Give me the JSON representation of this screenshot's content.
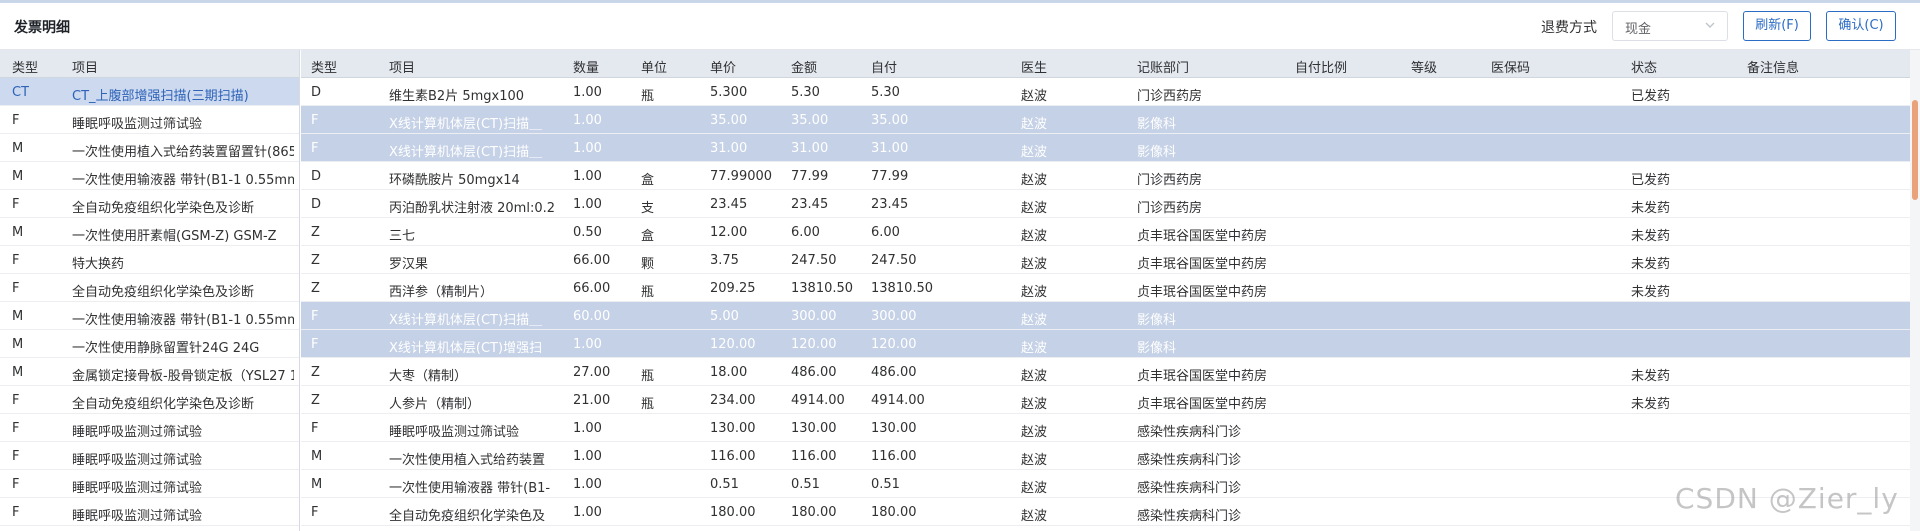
{
  "header": {
    "title": "发票明细",
    "refund_label": "退费方式",
    "refund_value": "现金",
    "refresh_label": "刷新(F)",
    "confirm_label": "确认(C)"
  },
  "left_table": {
    "columns": [
      "类型",
      "项目"
    ],
    "rows": [
      [
        "CT",
        "CT_上腹部增强扫描(三期扫描)"
      ],
      [
        "F",
        "睡眠呼吸监测过筛试验"
      ],
      [
        "M",
        "一次性使用植入式给药装置留置针(865"
      ],
      [
        "M",
        "一次性使用输液器 带针(B1-1 0.55mm"
      ],
      [
        "F",
        "全自动免疫组织化学染色及诊断"
      ],
      [
        "M",
        "一次性使用肝素帽(GSM-Z) GSM-Z"
      ],
      [
        "F",
        "特大换药"
      ],
      [
        "F",
        "全自动免疫组织化学染色及诊断"
      ],
      [
        "M",
        "一次性使用输液器 带针(B1-1 0.55mm"
      ],
      [
        "M",
        "一次性使用静脉留置针24G 24G"
      ],
      [
        "M",
        "金属锁定接骨板-股骨锁定板（YSL27 1"
      ],
      [
        "F",
        "全自动免疫组织化学染色及诊断"
      ],
      [
        "F",
        "睡眠呼吸监测过筛试验"
      ],
      [
        "F",
        "睡眠呼吸监测过筛试验"
      ],
      [
        "F",
        "睡眠呼吸监测过筛试验"
      ],
      [
        "F",
        "睡眠呼吸监测过筛试验"
      ]
    ]
  },
  "right_table": {
    "columns": [
      "类型",
      "项目",
      "数量",
      "单位",
      "单价",
      "金额",
      "自付",
      "医生",
      "记账部门",
      "自付比例",
      "等级",
      "医保码",
      "状态",
      "备注信息"
    ],
    "rows": [
      {
        "cells": [
          "D",
          "维生素B2片 5mgx100",
          "1.00",
          "瓶",
          "5.300",
          "5.30",
          "5.30",
          "赵波",
          "门诊西药房",
          "",
          "",
          "",
          "已发药",
          ""
        ],
        "style": ""
      },
      {
        "cells": [
          "F",
          "X线计算机体层(CT)扫描＿",
          "1.00",
          "",
          "35.00",
          "35.00",
          "35.00",
          "赵波",
          "影像科",
          "",
          "",
          "",
          "",
          ""
        ],
        "style": "blue"
      },
      {
        "cells": [
          "F",
          "X线计算机体层(CT)扫描＿",
          "1.00",
          "",
          "31.00",
          "31.00",
          "31.00",
          "赵波",
          "影像科",
          "",
          "",
          "",
          "",
          ""
        ],
        "style": "blue"
      },
      {
        "cells": [
          "D",
          "环磷酰胺片 50mgx14",
          "1.00",
          "盒",
          "77.99000",
          "77.99",
          "77.99",
          "赵波",
          "门诊西药房",
          "",
          "",
          "",
          "已发药",
          ""
        ],
        "style": ""
      },
      {
        "cells": [
          "D",
          "丙泊酚乳状注射液 20ml:0.2",
          "1.00",
          "支",
          "23.45",
          "23.45",
          "23.45",
          "赵波",
          "门诊西药房",
          "",
          "",
          "",
          "未发药",
          ""
        ],
        "style": ""
      },
      {
        "cells": [
          "Z",
          "三七",
          "0.50",
          "盒",
          "12.00",
          "6.00",
          "6.00",
          "赵波",
          "贞丰珉谷国医堂中药房",
          "",
          "",
          "",
          "未发药",
          ""
        ],
        "style": ""
      },
      {
        "cells": [
          "Z",
          "罗汉果",
          "66.00",
          "颗",
          "3.75",
          "247.50",
          "247.50",
          "赵波",
          "贞丰珉谷国医堂中药房",
          "",
          "",
          "",
          "未发药",
          ""
        ],
        "style": ""
      },
      {
        "cells": [
          "Z",
          "西洋参（精制片）",
          "66.00",
          "瓶",
          "209.25",
          "13810.50",
          "13810.50",
          "赵波",
          "贞丰珉谷国医堂中药房",
          "",
          "",
          "",
          "未发药",
          ""
        ],
        "style": ""
      },
      {
        "cells": [
          "F",
          "X线计算机体层(CT)扫描＿",
          "60.00",
          "",
          "5.00",
          "300.00",
          "300.00",
          "赵波",
          "影像科",
          "",
          "",
          "",
          "",
          ""
        ],
        "style": "blue"
      },
      {
        "cells": [
          "F",
          "X线计算机体层(CT)增强扫",
          "1.00",
          "",
          "120.00",
          "120.00",
          "120.00",
          "赵波",
          "影像科",
          "",
          "",
          "",
          "",
          ""
        ],
        "style": "blue"
      },
      {
        "cells": [
          "Z",
          "大枣（精制）",
          "27.00",
          "瓶",
          "18.00",
          "486.00",
          "486.00",
          "赵波",
          "贞丰珉谷国医堂中药房",
          "",
          "",
          "",
          "未发药",
          ""
        ],
        "style": ""
      },
      {
        "cells": [
          "Z",
          "人参片（精制）",
          "21.00",
          "瓶",
          "234.00",
          "4914.00",
          "4914.00",
          "赵波",
          "贞丰珉谷国医堂中药房",
          "",
          "",
          "",
          "未发药",
          ""
        ],
        "style": ""
      },
      {
        "cells": [
          "F",
          "睡眠呼吸监测过筛试验",
          "1.00",
          "",
          "130.00",
          "130.00",
          "130.00",
          "赵波",
          "感染性疾病科门诊",
          "",
          "",
          "",
          "",
          ""
        ],
        "style": ""
      },
      {
        "cells": [
          "M",
          "一次性使用植入式给药装置",
          "1.00",
          "",
          "116.00",
          "116.00",
          "116.00",
          "赵波",
          "感染性疾病科门诊",
          "",
          "",
          "",
          "",
          ""
        ],
        "style": ""
      },
      {
        "cells": [
          "M",
          "一次性使用输液器 带针(B1-",
          "1.00",
          "",
          "0.51",
          "0.51",
          "0.51",
          "赵波",
          "感染性疾病科门诊",
          "",
          "",
          "",
          "",
          ""
        ],
        "style": ""
      },
      {
        "cells": [
          "F",
          "全自动免疫组织化学染色及",
          "1.00",
          "",
          "180.00",
          "180.00",
          "180.00",
          "赵波",
          "感染性疾病科门诊",
          "",
          "",
          "",
          "",
          ""
        ],
        "style": ""
      }
    ]
  },
  "watermark": "CSDN @Zier_ly",
  "colors": {
    "accent": "#2b6cc4",
    "selected_row": "#ccd9ef",
    "blue_row": "#c5d1e6",
    "header_bg": "#e4e9f0",
    "scroll_thumb": "#e9a27a"
  },
  "icons": {
    "refund_select": "chevron-down-icon"
  }
}
